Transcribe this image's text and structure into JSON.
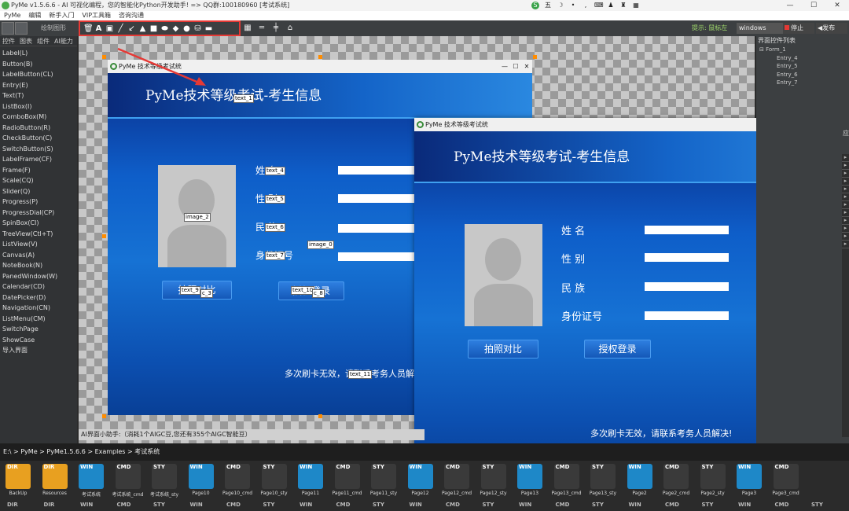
{
  "titlebar": {
    "title": "PyMe v1.5.6.6 - AI 可视化编程，您的智能化Python开发助手!    => QQ群:100180960    [考试系统]",
    "ime_label": "五",
    "controls": [
      "—",
      "☐",
      "✕"
    ]
  },
  "menu": [
    "PyMe",
    "编辑",
    "新手入门",
    "VIP工具箱",
    "咨询沟通"
  ],
  "toolbar": {
    "mode_label": "绘制图形",
    "hint": "提示: 鼠标左",
    "platform": "windows",
    "stop_label": "停止",
    "publish_label": "◀发布"
  },
  "left_tabs": [
    "控件",
    "图表",
    "组件",
    "AI能力"
  ],
  "widgets": [
    "Label(L)",
    "Button(B)",
    "LabelButton(CL)",
    "Entry(E)",
    "Text(T)",
    "ListBox(I)",
    "ComboBox(M)",
    "RadioButton(R)",
    "CheckButton(C)",
    "SwitchButton(S)",
    "LabelFrame(CF)",
    "Frame(F)",
    "Scale(CQ)",
    "Slider(Q)",
    "Progress(P)",
    "ProgressDial(CP)",
    "SpinBox(CI)",
    "TreeView(Ctl+T)",
    "ListView(V)",
    "Canvas(A)",
    "NoteBook(N)",
    "PanedWindow(W)",
    "Calendar(CD)",
    "DatePicker(D)",
    "Navigation(CN)",
    "ListMenu(CM)",
    "SwitchPage",
    "ShowCase",
    "导入界面"
  ],
  "right_panel": {
    "title": "界面控件列表",
    "tree": [
      "⊟ Form_1",
      "Entry_4",
      "Entry_5",
      "Entry_6",
      "Entry_7"
    ],
    "side_label": "应"
  },
  "design_window": {
    "title": "PyMe 技术等级考试统",
    "banner": "PyMe技术等级考试-考生信息",
    "labels": [
      "姓  名",
      "性  别",
      "民  族",
      "身份证号"
    ],
    "buttons": [
      "拍照对比",
      "授权登录"
    ],
    "footer": "多次刷卡无效，请联系考务人员解决!",
    "tags": [
      "text_1",
      "text_4",
      "text_5",
      "text_6",
      "text_7",
      "image_2",
      "image_0",
      "text_9",
      "text_10",
      "text_11",
      "c_3",
      "c_8"
    ]
  },
  "preview_window": {
    "title": "PyMe 技术等级考试统",
    "banner": "PyMe技术等级考试-考生信息",
    "labels": [
      "姓    名",
      "性    别",
      "民    族",
      "身份证号"
    ],
    "buttons": [
      "拍照对比",
      "授权登录"
    ],
    "footer": "多次刷卡无效，请联系考务人员解决!"
  },
  "ai_bar": "AI界面小助手:（消耗1个AIGC豆,您还有355个AIGC智能豆）",
  "path": "E:\\ > PyMe > PyMe1.5.6.6 > Examples > 考试系统",
  "files": [
    {
      "type": "DIR",
      "name": "BackUp",
      "color": "#e8a020"
    },
    {
      "type": "DIR",
      "name": "Resources",
      "color": "#e8a020"
    },
    {
      "type": "WIN",
      "name": "考试系统",
      "color": "#1e88c8"
    },
    {
      "type": "CMD",
      "name": "考试系统_cmd",
      "color": "#3a3a3a"
    },
    {
      "type": "STY",
      "name": "考试系统_sty",
      "color": "#3a3a3a"
    },
    {
      "type": "WIN",
      "name": "Page10",
      "color": "#1e88c8"
    },
    {
      "type": "CMD",
      "name": "Page10_cmd",
      "color": "#3a3a3a"
    },
    {
      "type": "STY",
      "name": "Page10_sty",
      "color": "#3a3a3a"
    },
    {
      "type": "WIN",
      "name": "Page11",
      "color": "#1e88c8"
    },
    {
      "type": "CMD",
      "name": "Page11_cmd",
      "color": "#3a3a3a"
    },
    {
      "type": "STY",
      "name": "Page11_sty",
      "color": "#3a3a3a"
    },
    {
      "type": "WIN",
      "name": "Page12",
      "color": "#1e88c8"
    },
    {
      "type": "CMD",
      "name": "Page12_cmd",
      "color": "#3a3a3a"
    },
    {
      "type": "STY",
      "name": "Page12_sty",
      "color": "#3a3a3a"
    },
    {
      "type": "WIN",
      "name": "Page13",
      "color": "#1e88c8"
    },
    {
      "type": "CMD",
      "name": "Page13_cmd",
      "color": "#3a3a3a"
    },
    {
      "type": "STY",
      "name": "Page13_sty",
      "color": "#3a3a3a"
    },
    {
      "type": "WIN",
      "name": "Page2",
      "color": "#1e88c8"
    },
    {
      "type": "CMD",
      "name": "Page2_cmd",
      "color": "#3a3a3a"
    },
    {
      "type": "STY",
      "name": "Page2_sty",
      "color": "#3a3a3a"
    },
    {
      "type": "WIN",
      "name": "Page3",
      "color": "#1e88c8"
    },
    {
      "type": "CMD",
      "name": "Page3_cmd",
      "color": "#3a3a3a"
    }
  ],
  "files_row2": [
    "DIR",
    "DIR",
    "WIN",
    "CMD",
    "STY",
    "WIN",
    "CMD",
    "STY",
    "WIN",
    "CMD",
    "STY",
    "WIN",
    "CMD",
    "STY",
    "WIN",
    "CMD",
    "STY",
    "WIN",
    "CMD",
    "STY",
    "WIN",
    "CMD",
    "STY"
  ],
  "colors": {
    "accent_red": "#e53935",
    "banner_blue": "#0e5ec9",
    "handle_orange": "#ff8c00"
  }
}
